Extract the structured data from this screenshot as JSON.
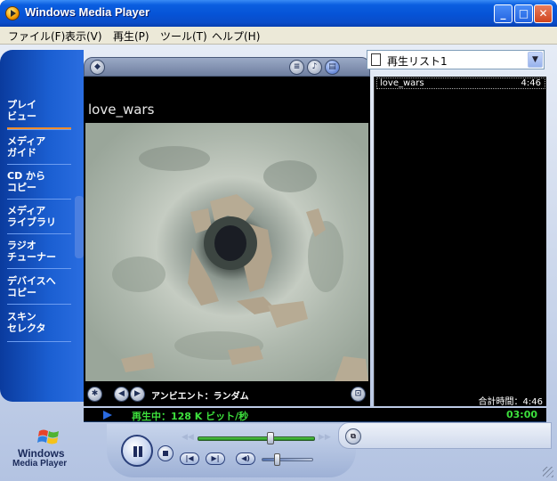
{
  "window": {
    "title": "Windows Media Player",
    "minimize_icon": "_",
    "maximize_icon": "□",
    "close_icon": "✕"
  },
  "menu": {
    "items": [
      "ファイル(F)",
      "表示(V)",
      "再生(P)",
      "ツール(T)",
      "ヘルプ(H)"
    ]
  },
  "sidebar": {
    "items": [
      {
        "label": "プレイ\nビュー"
      },
      {
        "label": "メディア\nガイド"
      },
      {
        "label": "CD から\nコピー"
      },
      {
        "label": "メディア\nライブラリ"
      },
      {
        "label": "ラジオ\nチューナー"
      },
      {
        "label": "デバイスへ\nコピー"
      },
      {
        "label": "スキン\nセレクタ"
      }
    ]
  },
  "logo": {
    "line1": "Windows",
    "line2": "Media Player"
  },
  "now_playing": {
    "track_title": "love_wars",
    "visualization": "アンビエント：ランダム"
  },
  "playlist": {
    "selected": "再生リスト1",
    "tracks": [
      {
        "title": "love_wars",
        "duration": "4:46"
      }
    ],
    "total_time": "合計時間：4:46"
  },
  "status": {
    "text": "再生中：128 K ビット/秒",
    "time": "03:00"
  },
  "colors": {
    "status_green": "#3de03d",
    "sidebar_blue": "#1b5fd2",
    "accent_orange": "#f08c2a"
  }
}
